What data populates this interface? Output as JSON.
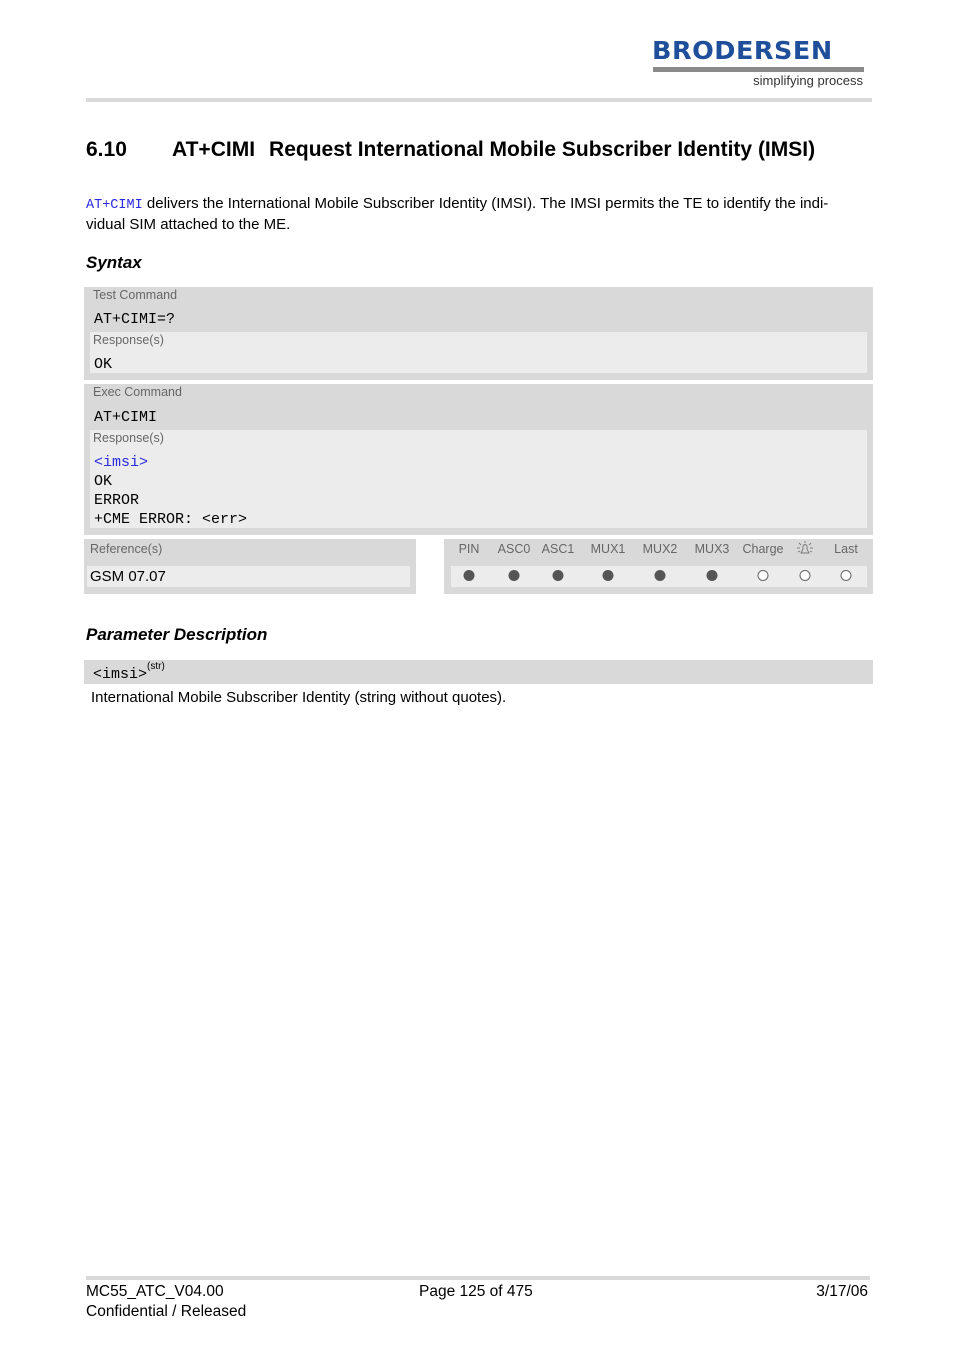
{
  "header": {
    "logo_word": "BRODERSEN",
    "logo_tagline": "simplifying process",
    "logo_color": "#1f4e9a"
  },
  "title": {
    "number": "6.10",
    "command": "AT+CIMI",
    "text": "Request International Mobile Subscriber Identity (IMSI)"
  },
  "intro": {
    "command_link": "AT+CIMI",
    "text_line1": " delivers the International Mobile Subscriber Identity (IMSI). The IMSI permits the TE to identify the indi-",
    "text_line2": "vidual SIM attached to the ME."
  },
  "syntax": {
    "heading": "Syntax",
    "test": {
      "label": "Test Command",
      "command": "AT+CIMI=?",
      "response_label": "Response(s)",
      "responses": [
        "OK"
      ]
    },
    "exec": {
      "label": "Exec Command",
      "command": "AT+CIMI",
      "response_label": "Response(s)",
      "responses": [
        "<imsi>",
        "OK",
        "ERROR",
        "+CME ERROR: <err>"
      ]
    },
    "reference": {
      "label": "Reference(s)",
      "value": "GSM 07.07"
    },
    "flags": [
      {
        "label": "PIN",
        "state": "filled"
      },
      {
        "label": "ASC0",
        "state": "filled"
      },
      {
        "label": "ASC1",
        "state": "filled"
      },
      {
        "label": "MUX1",
        "state": "filled"
      },
      {
        "label": "MUX2",
        "state": "filled"
      },
      {
        "label": "MUX3",
        "state": "filled"
      },
      {
        "label": "Charge",
        "state": "empty"
      },
      {
        "label": "",
        "icon": "alarm-bell-icon",
        "state": "empty"
      },
      {
        "label": "Last",
        "state": "empty"
      }
    ]
  },
  "parameters": {
    "heading": "Parameter Description",
    "items": [
      {
        "name": "<imsi>",
        "type": "(str)",
        "description": "International Mobile Subscriber Identity (string without quotes)."
      }
    ]
  },
  "footer": {
    "doc_id": "MC55_ATC_V04.00",
    "status": "Confidential / Released",
    "page": "Page 125 of 475",
    "date": "3/17/06"
  }
}
